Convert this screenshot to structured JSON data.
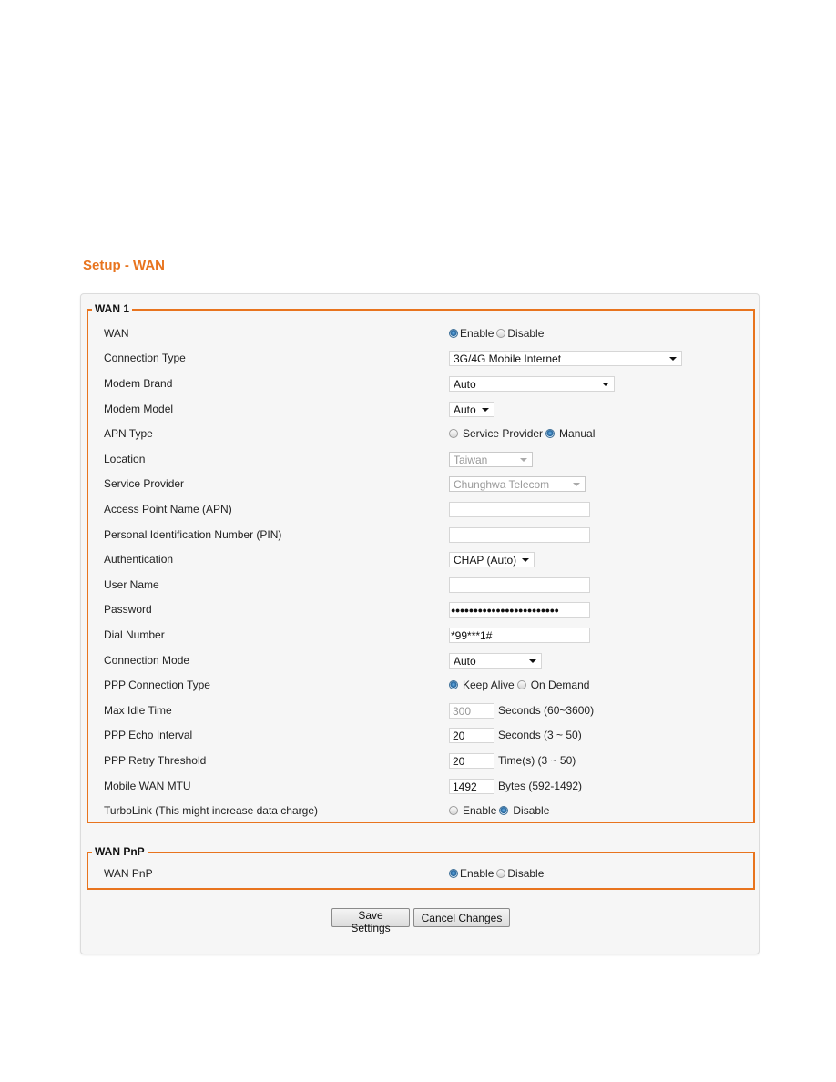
{
  "page_title": "Setup - WAN",
  "wan1": {
    "legend": "WAN 1",
    "rows": {
      "wan": {
        "label": "WAN",
        "options": [
          "Enable",
          "Disable"
        ],
        "selected": "Enable"
      },
      "connection_type": {
        "label": "Connection Type",
        "value": "3G/4G Mobile Internet"
      },
      "modem_brand": {
        "label": "Modem Brand",
        "value": "Auto"
      },
      "modem_model": {
        "label": "Modem Model",
        "value": "Auto"
      },
      "apn_type": {
        "label": "APN Type",
        "options": [
          "Service Provider",
          "Manual"
        ],
        "selected": "Manual"
      },
      "location": {
        "label": "Location",
        "value": "Taiwan"
      },
      "service_provider": {
        "label": "Service Provider",
        "value": "Chunghwa Telecom"
      },
      "apn": {
        "label": "Access Point Name (APN)",
        "value": ""
      },
      "pin": {
        "label": "Personal Identification Number (PIN)",
        "value": ""
      },
      "authentication": {
        "label": "Authentication",
        "value": "CHAP (Auto)"
      },
      "user_name": {
        "label": "User Name",
        "value": ""
      },
      "password": {
        "label": "Password",
        "value": "●●●●●●●●●●●●●●●●●●●●●●●●"
      },
      "dial_number": {
        "label": "Dial Number",
        "value": "*99***1#"
      },
      "connection_mode": {
        "label": "Connection Mode",
        "value": "Auto"
      },
      "ppp_connection_type": {
        "label": "PPP Connection Type",
        "options": [
          "Keep Alive",
          "On Demand"
        ],
        "selected": "Keep Alive"
      },
      "max_idle_time": {
        "label": "Max Idle Time",
        "value": "300",
        "unit": "Seconds (60~3600)"
      },
      "ppp_echo_interval": {
        "label": "PPP Echo Interval",
        "value": "20",
        "unit": "Seconds (3 ~ 50)"
      },
      "ppp_retry_threshold": {
        "label": "PPP Retry Threshold",
        "value": "20",
        "unit": "Time(s) (3 ~ 50)"
      },
      "mobile_wan_mtu": {
        "label": "Mobile WAN MTU",
        "value": "1492",
        "unit": "Bytes (592-1492)"
      },
      "turbolink": {
        "label": "TurboLink (This might increase data charge)",
        "options": [
          "Enable",
          "Disable"
        ],
        "selected": "Disable"
      }
    }
  },
  "wan_pnp": {
    "legend": "WAN PnP",
    "label": "WAN PnP",
    "options": [
      "Enable",
      "Disable"
    ],
    "selected": "Enable"
  },
  "buttons": {
    "save": "Save Settings",
    "cancel": "Cancel Changes"
  },
  "colors": {
    "accent": "#e8741e",
    "panel_bg": "#f6f6f6"
  }
}
